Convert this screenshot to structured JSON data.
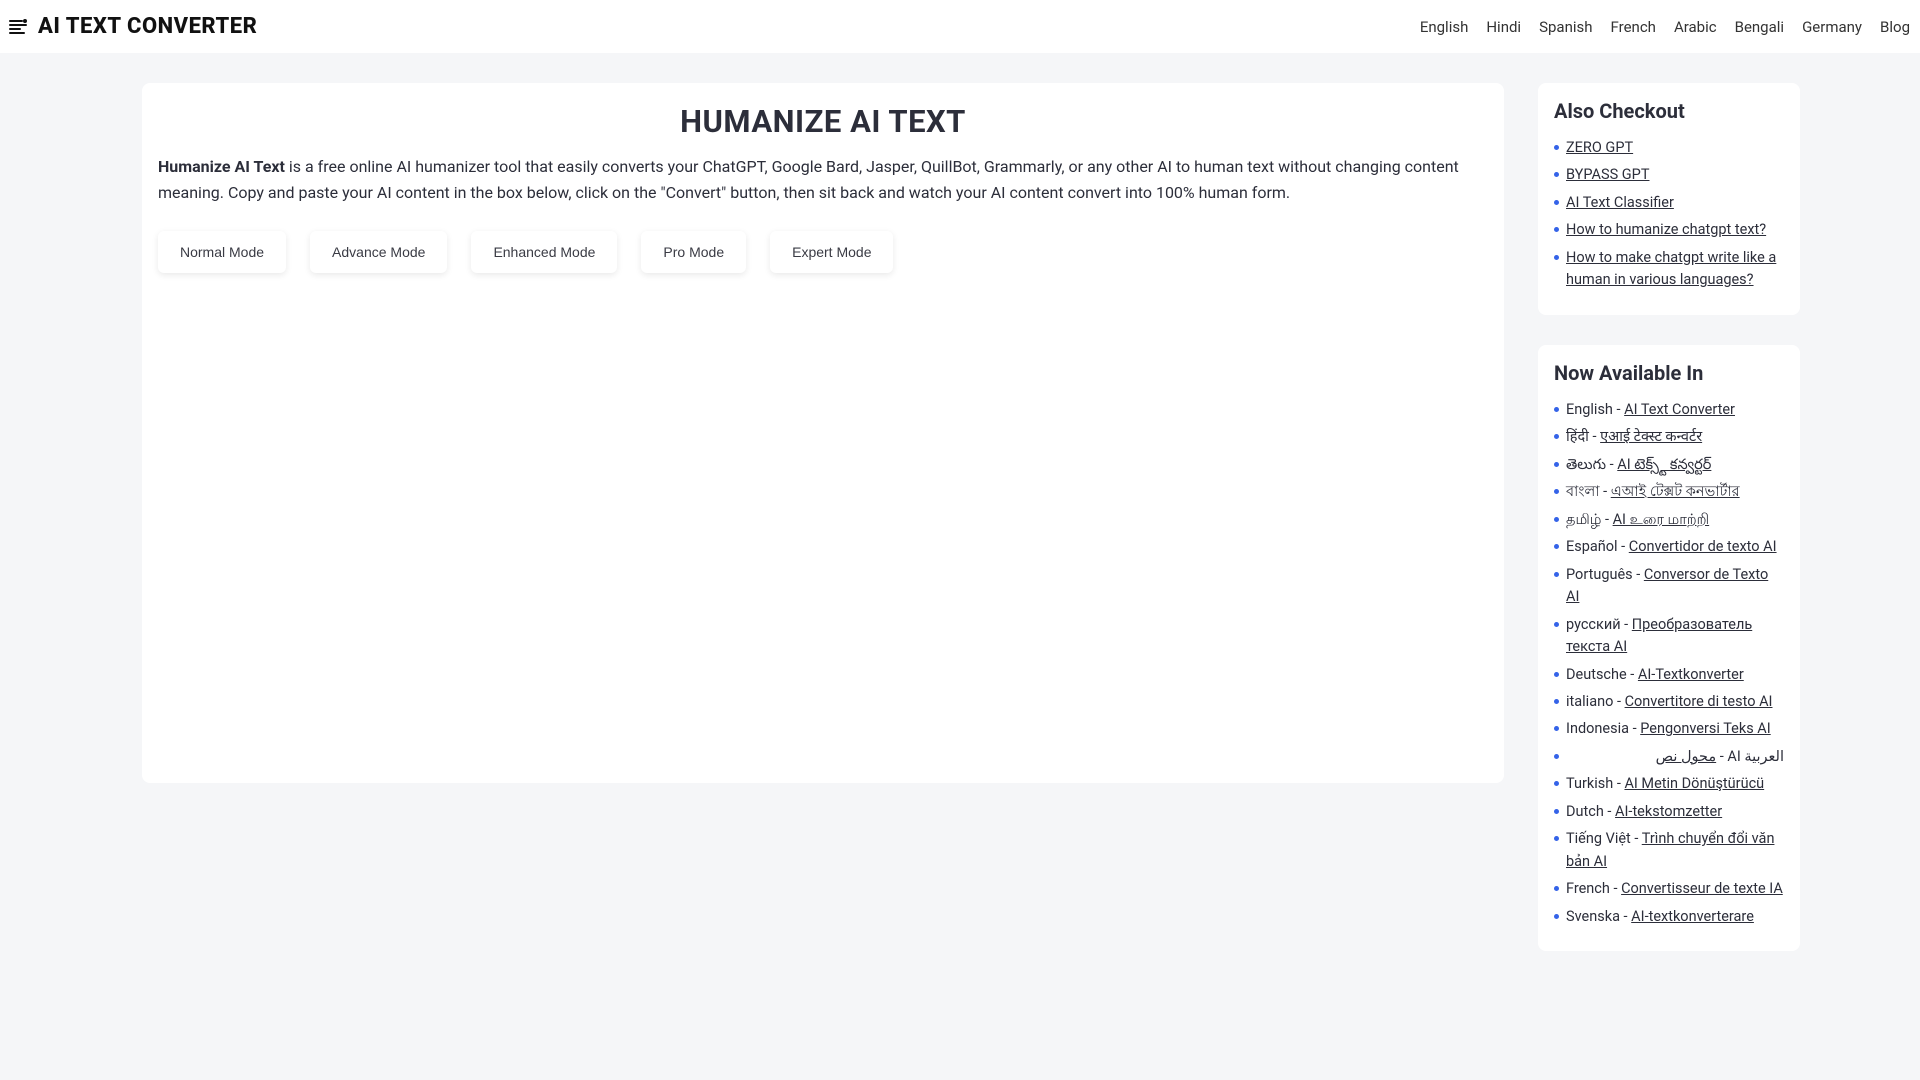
{
  "logo_text": "AI TEXT CONVERTER",
  "nav": [
    "English",
    "Hindi",
    "Spanish",
    "French",
    "Arabic",
    "Bengali",
    "Germany",
    "Blog"
  ],
  "main": {
    "title": "HUMANIZE AI TEXT",
    "intro_strong": "Humanize AI Text",
    "intro_rest": " is a free online AI humanizer tool that easily converts your ChatGPT, Google Bard, Jasper, QuillBot, Grammarly, or any other AI to human text without changing content meaning. Copy and paste your AI content in the box below, click on the \"Convert\" button, then sit back and watch your AI content convert into 100% human form.",
    "modes": [
      "Normal Mode",
      "Advance Mode",
      "Enhanced Mode",
      "Pro Mode",
      "Expert Mode"
    ]
  },
  "also": {
    "title": "Also Checkout",
    "items": [
      "ZERO GPT",
      "BYPASS GPT",
      "AI Text Classifier",
      "How to humanize chatgpt text?",
      "How to make chatgpt write like a human in various languages?"
    ]
  },
  "avail": {
    "title": "Now Available In",
    "items": [
      {
        "prefix": "English - ",
        "link": "AI Text Converter",
        "rtl": false
      },
      {
        "prefix": "हिंदी - ",
        "link": "एआई टेक्स्ट कन्वर्टर",
        "rtl": false
      },
      {
        "prefix": "తెలుగు - ",
        "link": "AI టెక్స్ట్ కన్వర్టర్",
        "rtl": false
      },
      {
        "prefix": "বাংলা - ",
        "link": "এআই টেক্সট কনভার্টার",
        "rtl": false
      },
      {
        "prefix": "தமிழ் - ",
        "link": "AI உரை மாற்றி",
        "rtl": false
      },
      {
        "prefix": "Español - ",
        "link": "Convertidor de texto AI",
        "rtl": false
      },
      {
        "prefix": "Português - ",
        "link": "Conversor de Texto AI",
        "rtl": false
      },
      {
        "prefix": "русский - ",
        "link": "Преобразователь текста AI",
        "rtl": false
      },
      {
        "prefix": "Deutsche - ",
        "link": "AI-Textkonverter",
        "rtl": false
      },
      {
        "prefix": "italiano - ",
        "link": "Convertitore di testo AI",
        "rtl": false
      },
      {
        "prefix": "Indonesia - ",
        "link": "Pengonversi Teks AI",
        "rtl": false
      },
      {
        "prefix": "العربية AI - ",
        "link": "محول نص",
        "rtl": true
      },
      {
        "prefix": "Turkish - ",
        "link": "AI Metin Dönüştürücü",
        "rtl": false
      },
      {
        "prefix": "Dutch - ",
        "link": "AI-tekstomzetter",
        "rtl": false
      },
      {
        "prefix": "Tiếng Việt - ",
        "link": "Trình chuyển đổi văn bản AI",
        "rtl": false
      },
      {
        "prefix": "French - ",
        "link": "Convertisseur de texte IA",
        "rtl": false
      },
      {
        "prefix": "Svenska - ",
        "link": "AI-textkonverterare",
        "rtl": false
      }
    ]
  }
}
